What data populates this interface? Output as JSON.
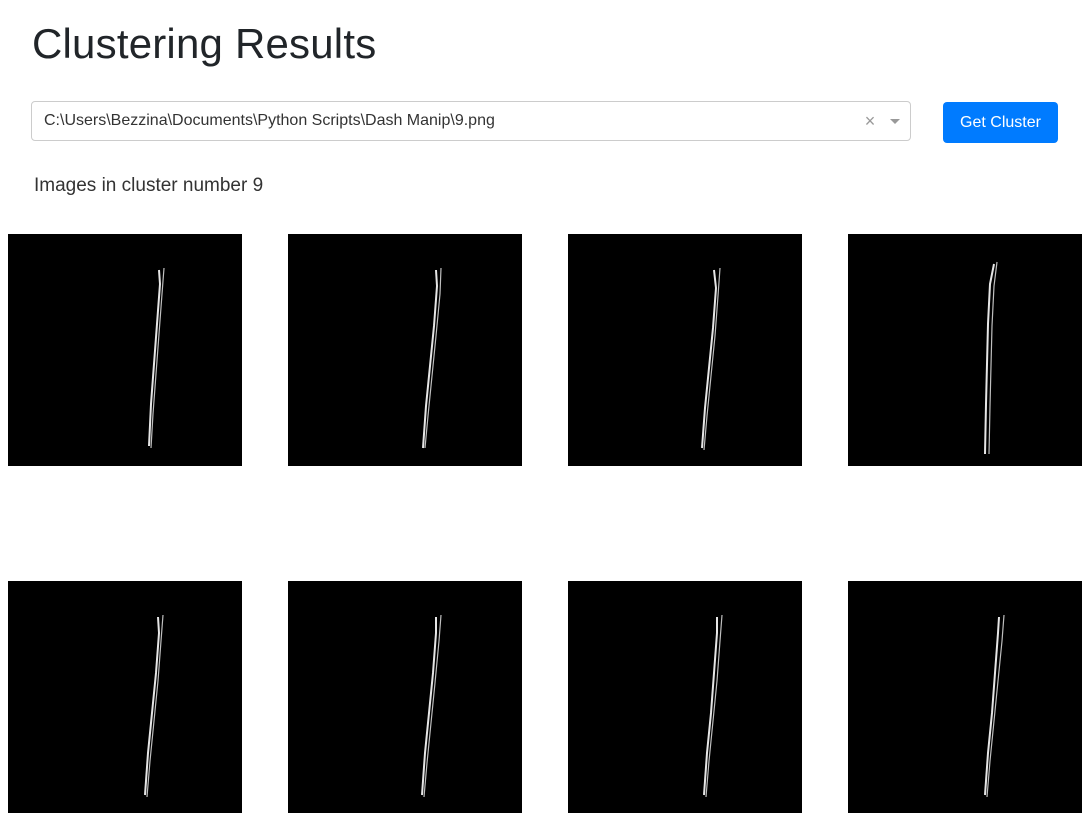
{
  "page": {
    "title": "Clustering Results"
  },
  "selector": {
    "value": "C:\\Users\\Bezzina\\Documents\\Python Scripts\\Dash Manip\\9.png",
    "clear_icon": "×",
    "arrow_icon": "chevron-down-icon"
  },
  "action": {
    "button_label": "Get Cluster"
  },
  "result": {
    "subtitle": "Images in cluster number 9",
    "images": [
      {
        "name": "cluster-image-1"
      },
      {
        "name": "cluster-image-2"
      },
      {
        "name": "cluster-image-3"
      },
      {
        "name": "cluster-image-4"
      },
      {
        "name": "cluster-image-5"
      },
      {
        "name": "cluster-image-6"
      },
      {
        "name": "cluster-image-7"
      },
      {
        "name": "cluster-image-8"
      }
    ]
  },
  "colors": {
    "button": "#007bff",
    "image_background": "#000000",
    "stroke": "#e6e6e6"
  }
}
